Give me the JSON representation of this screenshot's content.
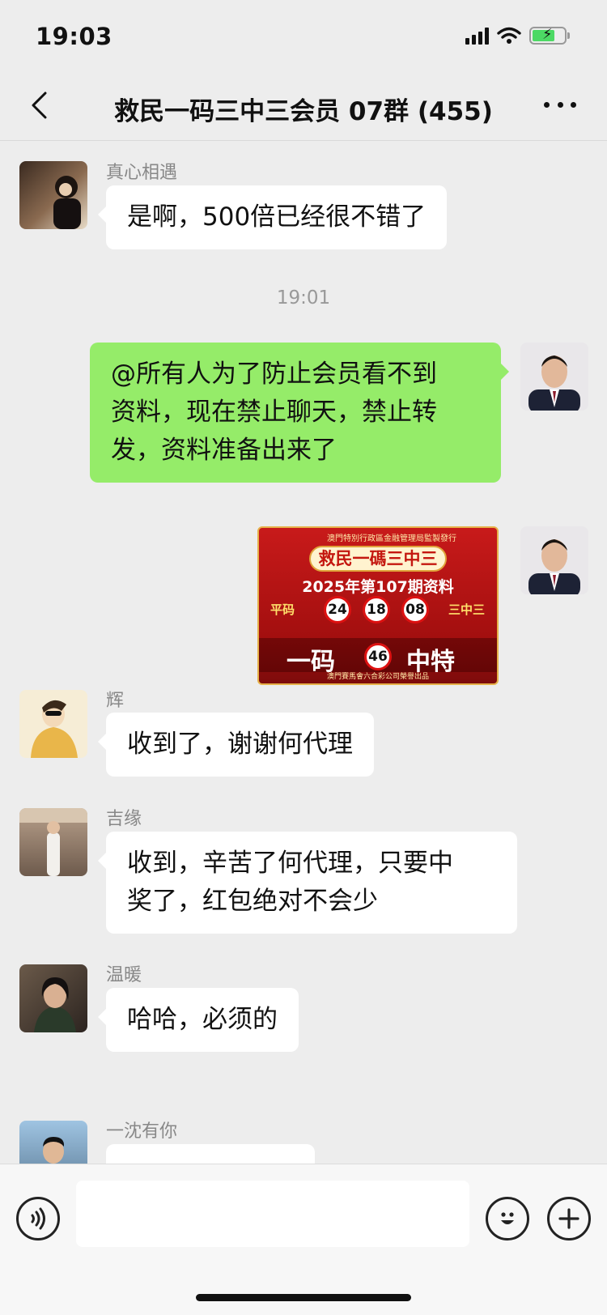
{
  "status_bar": {
    "time": "19:03"
  },
  "header": {
    "title": "救民一码三中三会员 07群 (455)"
  },
  "messages": [
    {
      "sender": "真心相遇",
      "text": "是啊，500倍已经很不错了"
    },
    {
      "timestamp": "19:01"
    },
    {
      "self_lines": [
        "@所有人为了防止会员看不到",
        "资料，现在禁止聊天，禁止转",
        "发，资料准备出来了"
      ]
    },
    {
      "sender": "辉",
      "text": "收到了，谢谢何代理"
    },
    {
      "sender": "吉缘",
      "lines": [
        "收到，辛苦了何代理，只要中",
        "奖了，红包绝对不会少"
      ]
    },
    {
      "sender": "温暖",
      "text": "哈哈，必须的"
    },
    {
      "sender": "一沈有你",
      "text": ""
    }
  ],
  "promo_image": {
    "top_text": "澳門特別行政區金融管理局監製發行",
    "banner": "救民一碼三中三",
    "issue": "2025年第107期资料",
    "label_left": "平码",
    "label_right": "三中三",
    "balls": [
      "24",
      "18",
      "08"
    ],
    "big_left": "一码",
    "special_ball": "46",
    "big_right": "中特",
    "footer": "澳門賽馬會六合彩公司榮譽出品"
  },
  "colors": {
    "self_bubble": "#95ec69",
    "background": "#ededed",
    "promo_red": "#c81a1a"
  },
  "icons": [
    "back-icon",
    "more-icon",
    "voice-icon",
    "emoji-icon",
    "plus-icon",
    "wifi-icon",
    "signal-icon",
    "battery-icon"
  ]
}
